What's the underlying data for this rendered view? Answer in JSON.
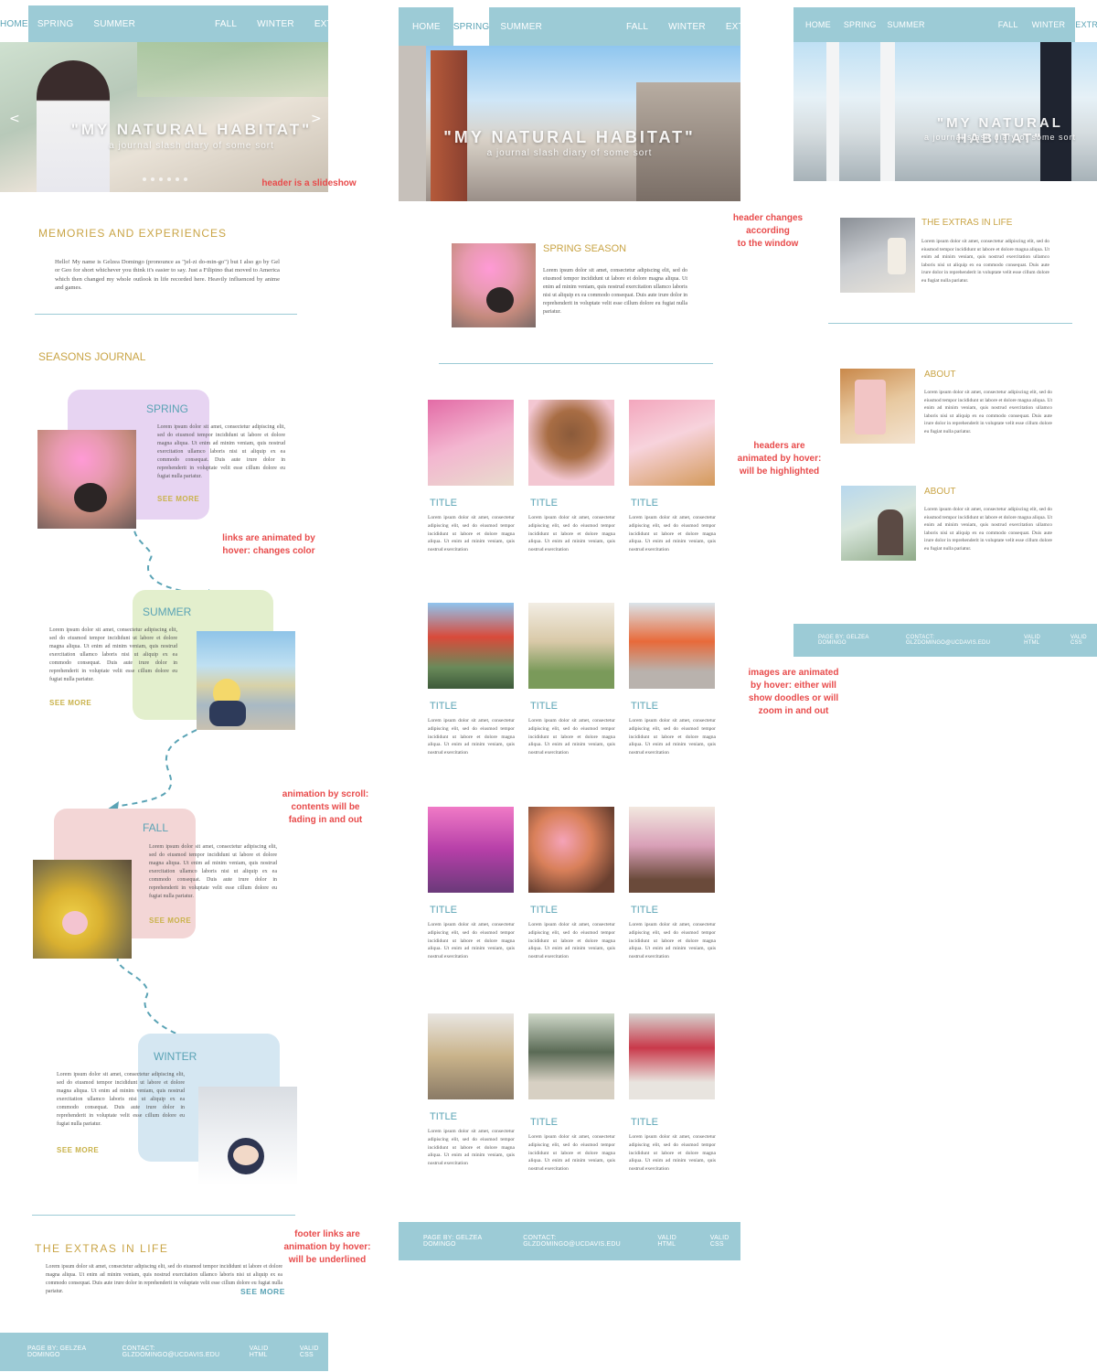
{
  "nav": {
    "home": "HOME",
    "spring": "SPRING",
    "summer": "SUMMER",
    "fall": "FALL",
    "winter": "WINTER",
    "extra": "EXTRA"
  },
  "hero": {
    "title": "\"MY NATURAL HABITAT\"",
    "subtitle": "a journal slash diary of some sort",
    "prev": "<",
    "next": ">"
  },
  "notes": {
    "slideshow": "header is a slideshow",
    "header_changes": "header changes\naccording\nto the window",
    "links_hover": "links are animated by\nhover: changes color",
    "headers_hover": "headers are\nanimated by hover:\nwill be highlighted",
    "images_hover": "images are animated\nby hover: either will\nshow doodles or will\nzoom in and out",
    "scroll": "animation by scroll:\ncontents will be\nfading in and out",
    "footer": "footer links are\nanimation by hover:\nwill be underlined"
  },
  "home": {
    "memories_heading": "MEMORIES AND EXPERIENCES",
    "intro": "Hello! My name is Gelzea Domingo (pronounce as \"jel-zi do-min-go\") but I also go by Gel or Geo for short whichever you think it's easier to say. Just a Filipino that moved to America which then changed my whole outlook in life recorded here.  Heavily influenced by anime and games.",
    "seasons_heading": "SEASONS JOURNAL",
    "seasons": [
      {
        "name": "SPRING",
        "see_more": "SEE MORE"
      },
      {
        "name": "SUMMER",
        "see_more": "SEE MORE"
      },
      {
        "name": "FALL",
        "see_more": "SEE MORE"
      },
      {
        "name": "WINTER",
        "see_more": "SEE MORE"
      }
    ],
    "extras_heading": "THE EXTRAS IN LIFE",
    "extras_text": "Lorem ipsum dolor sit amet, consectetur adipiscing elit, sed do eiusmod tempor incididunt ut labore et dolore magna aliqua. Ut enim ad minim veniam, quis nostrud exercitation ullamco laboris nisi ut aliquip ex ea commodo consequat. Duis aute irure dolor in reprehenderit in voluptate velit esse cillum dolore eu fugiat nulla pariatur.",
    "extras_see_more": "SEE MORE"
  },
  "lorem": {
    "season": "Lorem ipsum dolor sit amet, consectetur adipiscing elit, sed do eiusmod tempor incididunt ut labore et dolore magna aliqua. Ut enim ad minim veniam, quis nostrud exercitation ullamco laboris nisi ut aliquip ex ea commodo consequat. Duis aute irure dolor in reprehenderit in voluptate velit esse cillum dolore eu fugiat nulla pariatur.",
    "grid": "Lorem ipsum dolor sit amet, consectetur adipiscing elit, sed do eiusmod tempor incididunt ut labore et dolore magna aliqua. Ut enim ad minim veniam, quis nostrud exercitation"
  },
  "spring_page": {
    "heading": "SPRING SEASON",
    "tile_title": "TITLE"
  },
  "extra_page": {
    "heading": "THE EXTRAS IN LIFE",
    "about1": "ABOUT",
    "about2": "ABOUT"
  },
  "footer": {
    "page_by": "PAGE BY: GELZEA DOMINGO",
    "contact": "CONTACT: GLZDOMINGO@UCDAVIS.EDU",
    "valid_html": "VALID HTML",
    "valid_css": "VALID CSS"
  },
  "colors": {
    "nav": "#9ccbd6",
    "gold": "#c9a445",
    "teal": "#5aa3b5",
    "note": "#e84b4b",
    "spring_card": "#e7d4f2",
    "summer_card": "#e3efcd",
    "fall_card": "#f3d6d6",
    "winter_card": "#d5e7f2"
  }
}
